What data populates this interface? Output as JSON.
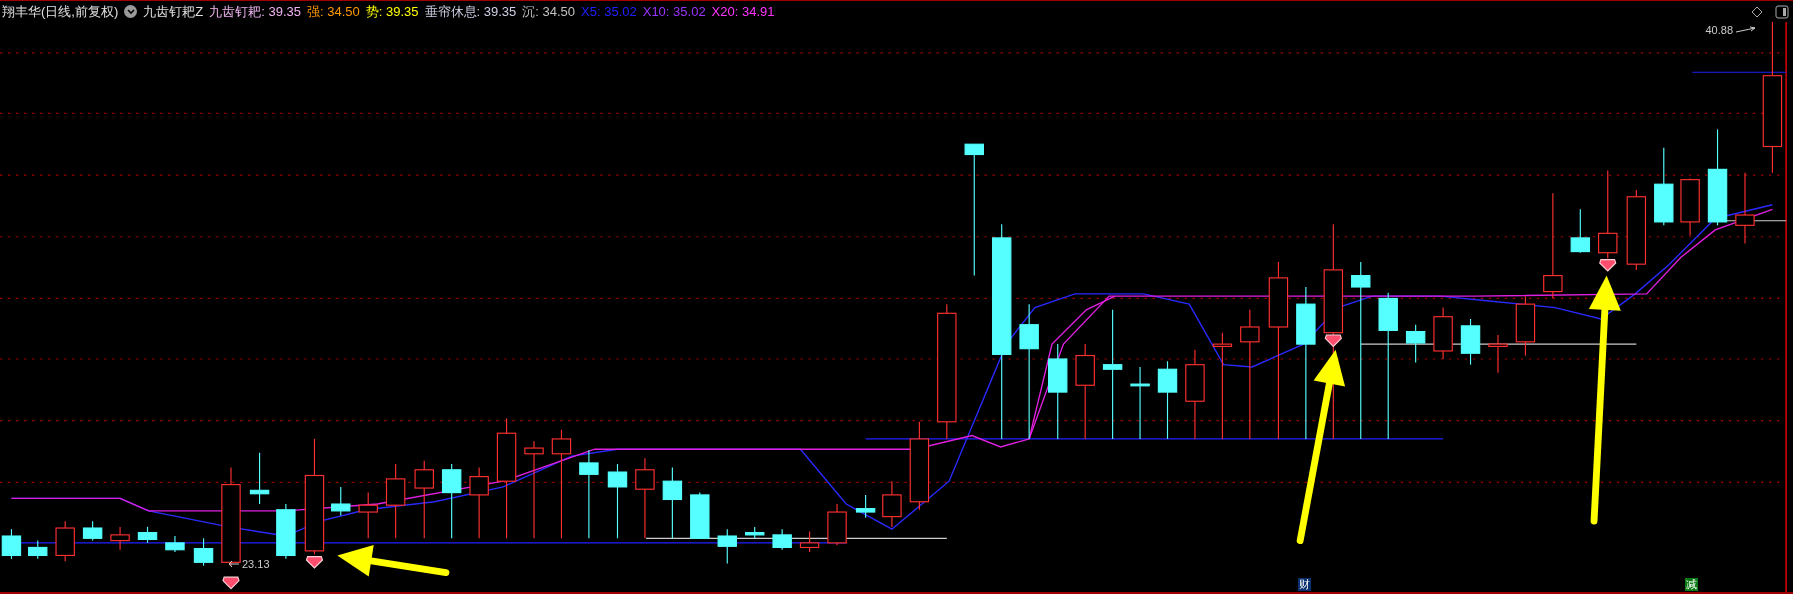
{
  "header": {
    "title": "翔丰华(日线,前复权)",
    "indicator": "九齿钉耙Z",
    "values": [
      {
        "text": "九齿钉耙: 39.35",
        "color": "#f0b4f0"
      },
      {
        "text": "强: 34.50",
        "color": "#ff9900"
      },
      {
        "text": "势: 39.35",
        "color": "#ffff00"
      },
      {
        "text": "垂帘休息: 39.35",
        "color": "#d0d0e8"
      },
      {
        "text": "沉: 34.50",
        "color": "#c0c0c0"
      },
      {
        "text": "X5: 35.02",
        "color": "#2020ff"
      },
      {
        "text": "X10: 35.02",
        "color": "#9933ff"
      },
      {
        "text": "X20: 34.91",
        "color": "#ff33ff"
      }
    ]
  },
  "price_labels": {
    "high": "40.88",
    "low": "23.13"
  },
  "markers": [
    {
      "text": "财",
      "color": "#0a2f6e"
    },
    {
      "text": "减",
      "color": "#0b7a14"
    }
  ]
}
